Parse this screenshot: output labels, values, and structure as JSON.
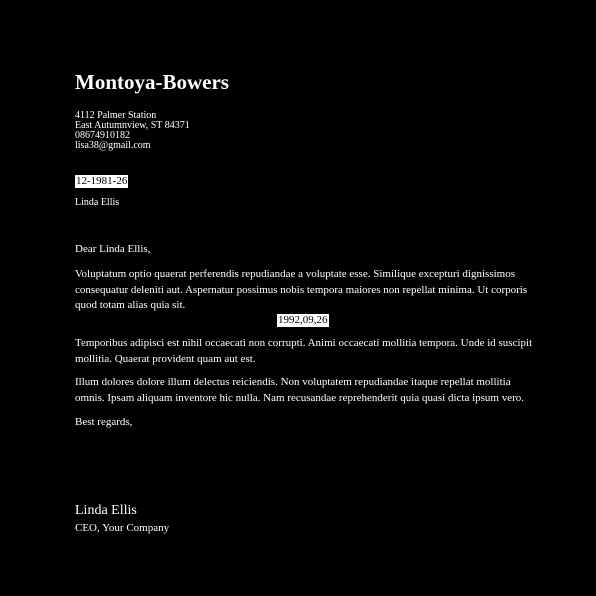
{
  "letterhead": {
    "company": "Montoya-Bowers",
    "address_line1": "4112 Palmer Station",
    "address_line2": "East Autumnview, ST 84371",
    "phone": "08674910182",
    "email": "lisa38@gmail.com"
  },
  "date": "12-1981-26",
  "recipient": "Linda Ellis",
  "salutation": "Dear Linda Ellis,",
  "paragraphs": [
    "Voluptatum optio quaerat perferendis repudiandae a voluptate esse. Similique excepturi dignissimos consequatur deleniti aut. Aspernatur possimus nobis tempora maiores non repellat minima. Ut corporis quod totam alias quia sit.",
    "Temporibus adipisci est nihil occaecati non corrupti. Animi occaecati mollitia tempora. Unde id suscipit mollitia. Quaerat provident quam aut est.",
    "Illum dolores dolore illum delectus reiciendis. Non voluptatem repudiandae itaque repellat mollitia omnis. Ipsam aliquam inventore hic nulla. Nam recusandae reprehenderit quia quasi dicta ipsum vero."
  ],
  "inline_date": "1992,09,26",
  "closing": "Best regards,",
  "signature": {
    "name": "Linda Ellis",
    "title": "CEO, Your Company"
  },
  "colors": {
    "background": "#000000",
    "text": "#ffffff",
    "highlight_bg": "#ffffff",
    "highlight_text": "#000000"
  }
}
